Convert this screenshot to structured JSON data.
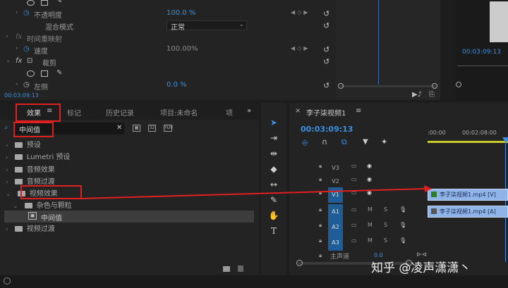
{
  "effect_controls": {
    "rows": [
      {
        "label": "不透明度",
        "value": "100.0 %",
        "value_blue": true
      },
      {
        "label": "混合模式",
        "value": "正常",
        "value_blue": false
      },
      {
        "label": "时间重映射",
        "value": "",
        "value_blue": false
      },
      {
        "label": "速度",
        "value": "100.00%",
        "value_blue": false
      },
      {
        "label": "裁剪",
        "value": "",
        "value_blue": false
      },
      {
        "label": "左侧",
        "value": "0.0 %",
        "value_blue": true
      }
    ],
    "fx_label": "fx",
    "timecode": "00:03:09:13"
  },
  "program": {
    "timecode": "00:03:09:13"
  },
  "effects_panel": {
    "tabs": [
      "效果",
      "标记",
      "历史记录",
      "项目:未命名",
      "项"
    ],
    "menu_icon": "≡",
    "overflow_icon": "»",
    "search_value": "中间值",
    "tree": [
      {
        "label": "预设",
        "indent": 0
      },
      {
        "label": "Lumetri 预设",
        "indent": 0
      },
      {
        "label": "音频效果",
        "indent": 0
      },
      {
        "label": "音频过渡",
        "indent": 0
      },
      {
        "label": "视频效果",
        "indent": 0
      },
      {
        "label": "杂色与颗粒",
        "indent": 1
      },
      {
        "label": "中间值",
        "indent": 2
      },
      {
        "label": "视频过渡",
        "indent": 0
      }
    ]
  },
  "timeline": {
    "title": "李子柒视频1",
    "menu_icon": "≡",
    "timecode": "00:03:09:13",
    "ruler": [
      ":00:00",
      "00:02:08:00"
    ],
    "tracks": [
      {
        "name": "V3",
        "type": "video"
      },
      {
        "name": "V2",
        "type": "video"
      },
      {
        "name": "V1",
        "type": "video"
      },
      {
        "name": "A1",
        "type": "audio"
      },
      {
        "name": "A2",
        "type": "audio"
      },
      {
        "name": "A3",
        "type": "audio"
      }
    ],
    "master_label": "主声道",
    "master_value": "0.0",
    "clip_video": "李子柒视频1.mp4 [V]",
    "clip_audio": "李子柒视频1.mp4 [A]",
    "mute": "M",
    "solo": "S"
  },
  "watermark": "知乎 @凌声潇潇丶",
  "colors": {
    "accent": "#3b8fe0",
    "highlight": "#e02020",
    "clip_video": "#8fb4e8",
    "clip_audio": "#8fb4e8",
    "track_name_bg": "#1f5d96"
  }
}
